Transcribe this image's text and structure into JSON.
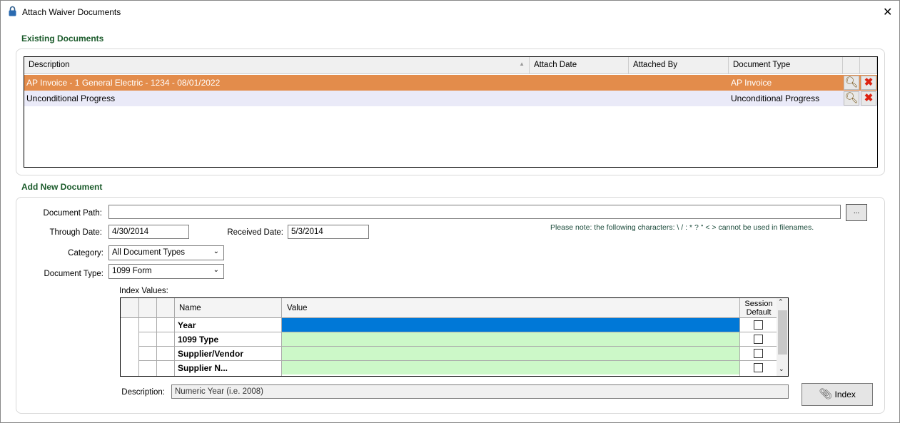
{
  "window": {
    "title": "Attach Waiver Documents",
    "icon": "lock-icon"
  },
  "existing": {
    "heading": "Existing Documents",
    "columns": [
      "Description",
      "Attach Date",
      "Attached By",
      "Document Type"
    ],
    "rows": [
      {
        "description": "AP Invoice - 1 General Electric - 1234 - 08/01/2022",
        "attach_date": "",
        "attached_by": "",
        "document_type": "AP Invoice",
        "selected": true
      },
      {
        "description": "Unconditional Progress",
        "attach_date": "",
        "attached_by": "",
        "document_type": "Unconditional Progress",
        "selected": false
      }
    ],
    "selected_color": "#e38c4b"
  },
  "add": {
    "heading": "Add New Document",
    "document_path_label": "Document Path:",
    "document_path": "",
    "browse_label": "...",
    "through_date_label": "Through Date:",
    "through_date": "4/30/2014",
    "received_date_label": "Received Date:",
    "received_date": "5/3/2014",
    "note": "Please note:  the following characters:  \\ / : * ? \" < > cannot be used in filenames.",
    "category_label": "Category:",
    "category": "All Document Types",
    "document_type_label": "Document Type:",
    "document_type": "1099 Form",
    "index_values_label": "Index Values:",
    "index_columns": [
      "Name",
      "Value",
      "Session Default"
    ],
    "index_rows": [
      {
        "name": "Year",
        "value": "",
        "session_default": false
      },
      {
        "name": "1099 Type",
        "value": "",
        "session_default": false
      },
      {
        "name": "Supplier/Vendor",
        "value": "",
        "session_default": false
      },
      {
        "name": "Supplier N...",
        "value": "",
        "session_default": false
      }
    ],
    "description_label": "Description:",
    "description": "Numeric Year (i.e. 2008)",
    "index_button": "Index"
  }
}
